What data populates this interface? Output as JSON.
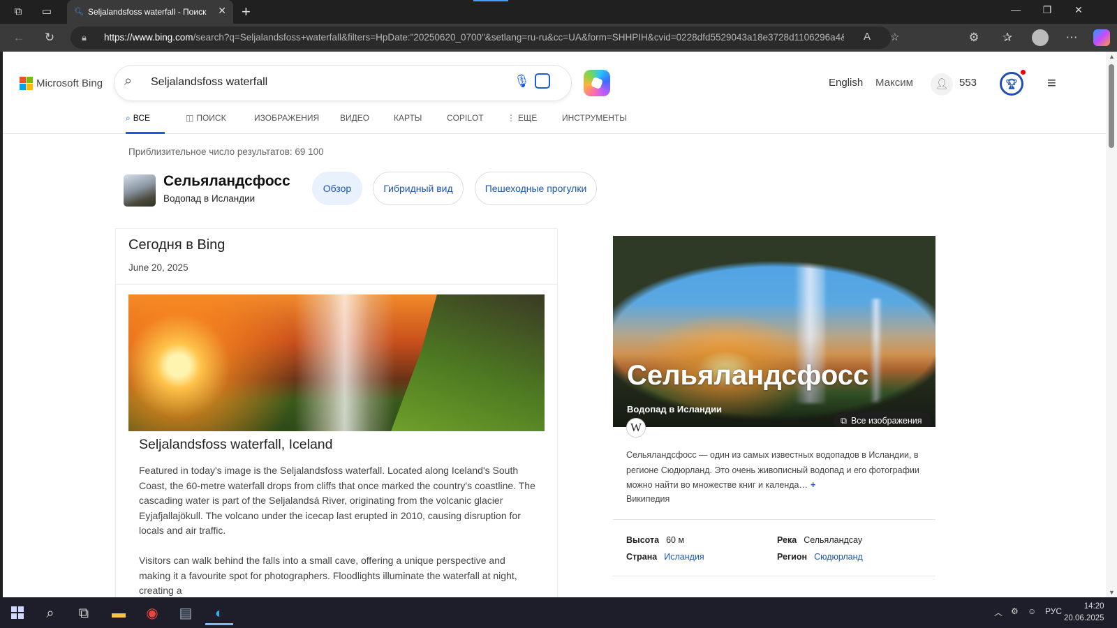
{
  "browser": {
    "tab_title": "Seljalandsfoss waterfall - Поиск",
    "url_host": "https://www.bing.com",
    "url_path": "/search?q=Seljalandsfoss+waterfall&filters=HpDate:\"20250620_0700\"&setlang=ru-ru&cc=UA&form=SHHPIH&cvid=0228dfd5529043a18e3728d1106296a4&..."
  },
  "header": {
    "logo_text": "Microsoft Bing",
    "search_query": "Seljalandsfoss waterfall",
    "language_link": "English",
    "user_name": "Максим",
    "rewards_points": "553"
  },
  "nav_tabs": [
    {
      "label": "ВСЕ",
      "icon": "search-icon"
    },
    {
      "label": "ПОИСК",
      "icon": "copilot-search-icon"
    },
    {
      "label": "ИЗОБРАЖЕНИЯ"
    },
    {
      "label": "ВИДЕО"
    },
    {
      "label": "КАРТЫ"
    },
    {
      "label": "COPILOT"
    },
    {
      "label": "ЕЩЕ",
      "icon": "more-vertical-icon"
    },
    {
      "label": "ИНСТРУМЕНТЫ"
    }
  ],
  "results": {
    "count_text": "Приблизительное число результатов: 69 100"
  },
  "entity": {
    "title": "Сельяландсфосс",
    "subtitle": "Водопад в Исландии",
    "pills": [
      "Обзор",
      "Гибридный вид",
      "Пешеходные прогулки"
    ]
  },
  "today": {
    "heading": "Сегодня в Bing",
    "date": "June 20, 2025",
    "card_title": "Seljalandsfoss waterfall, Iceland",
    "para1": "Featured in today's image is the Seljalandsfoss waterfall. Located along Iceland's South Coast, the 60-metre waterfall drops from cliffs that once marked the country's coastline. The cascading water is part of the Seljalandsá River, originating from the volcanic glacier Eyjafjallajökull. The volcano under the icecap last erupted in 2010, causing disruption for locals and air traffic.",
    "para2": "Visitors can walk behind the falls into a small cave, offering a unique perspective and making it a favourite spot for photographers. Floodlights illuminate the waterfall at night, creating a"
  },
  "sidebar": {
    "title": "Сельяландсфосс",
    "subtitle": "Водопад в Исландии",
    "all_images": "Все изображения",
    "description": "Сельяландсфосс — один из самых известных водопадов в Исландии, в регионе Сюдюрланд. Это очень живописный водопад и его фотографии можно найти во множестве книг и календа…",
    "more": "+",
    "source": "Википедия",
    "facts": {
      "height_label": "Высота",
      "height_value": "60 м",
      "country_label": "Страна",
      "country_value": "Исландия",
      "river_label": "Река",
      "river_value": "Сельяландсау",
      "region_label": "Регион",
      "region_value": "Сюдюрланд"
    }
  },
  "taskbar": {
    "lang": "РУС",
    "time": "14:20",
    "date": "20.06.2025"
  },
  "colors": {
    "accent": "#1a5cd8",
    "link": "#1a55b5"
  }
}
